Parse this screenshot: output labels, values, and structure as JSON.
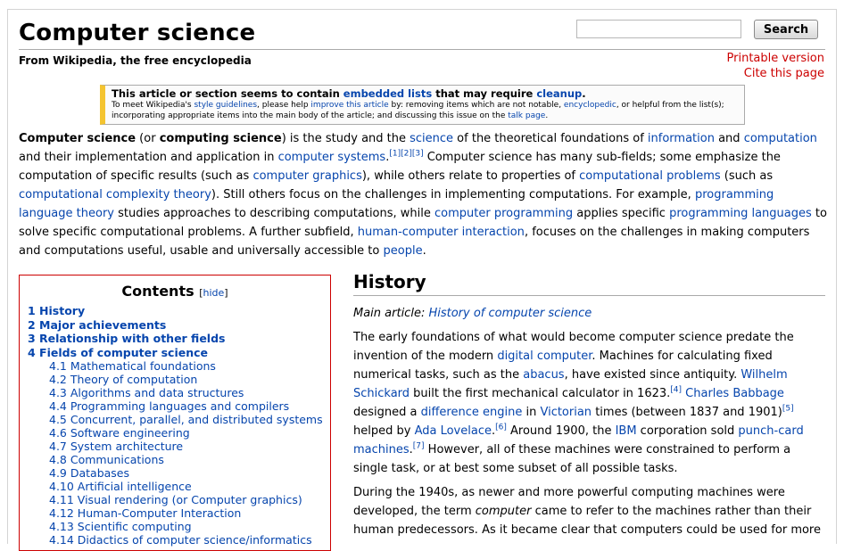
{
  "article": {
    "title": "Computer science",
    "tagline": "From Wikipedia, the free encyclopedia"
  },
  "search": {
    "placeholder": "",
    "value": "",
    "button_label": "Search"
  },
  "pagetools": {
    "printable": "Printable version",
    "cite": "Cite this page"
  },
  "ambox": {
    "lead": [
      "This article or section seems to contain ",
      "embedded lists",
      " that may require ",
      "cleanup",
      "."
    ],
    "body": [
      "To meet Wikipedia's ",
      "style guidelines",
      ", please help ",
      "improve this article",
      " by: removing items which are not notable, ",
      "encyclopedic",
      ", or helpful from the list(s); incorporating appropriate items into the main body of the article; and discussing this issue on the ",
      "talk page",
      "."
    ]
  },
  "intro": [
    "Computer science",
    " (or ",
    "computing science",
    ") is the study and the ",
    "science",
    " of the theoretical foundations of ",
    "information",
    " and ",
    "computation",
    " and their implementation and application in ",
    "computer systems",
    ".",
    "[1][2][3]",
    " Computer science has many sub-fields; some emphasize the computation of specific results (such as ",
    "computer graphics",
    "), while others relate to properties of ",
    "computational problems",
    " (such as ",
    "computational complexity theory",
    "). Still others focus on the challenges in implementing computations. For example, ",
    "programming language theory",
    " studies approaches to describing computations, while ",
    "computer programming",
    " applies specific ",
    "programming languages",
    " to solve specific computational problems. A further subfield, ",
    "human-computer interaction",
    ", focuses on the challenges in making computers and computations useful, usable and universally accessible to ",
    "people",
    "."
  ],
  "toc": {
    "title": "Contents",
    "hide_open": "[",
    "hide_label": "hide",
    "hide_close": "]",
    "items": [
      {
        "level": 1,
        "label": "1 History"
      },
      {
        "level": 1,
        "label": "2 Major achievements"
      },
      {
        "level": 1,
        "label": "3 Relationship with other fields"
      },
      {
        "level": 1,
        "label": "4 Fields of computer science"
      },
      {
        "level": 2,
        "label": "4.1 Mathematical foundations"
      },
      {
        "level": 2,
        "label": "4.2 Theory of computation"
      },
      {
        "level": 2,
        "label": "4.3 Algorithms and data structures"
      },
      {
        "level": 2,
        "label": "4.4 Programming languages and compilers"
      },
      {
        "level": 2,
        "label": "4.5 Concurrent, parallel, and distributed systems"
      },
      {
        "level": 2,
        "label": "4.6 Software engineering"
      },
      {
        "level": 2,
        "label": "4.7 System architecture"
      },
      {
        "level": 2,
        "label": "4.8 Communications"
      },
      {
        "level": 2,
        "label": "4.9 Databases"
      },
      {
        "level": 2,
        "label": "4.10 Artificial intelligence"
      },
      {
        "level": 2,
        "label": "4.11 Visual rendering (or Computer graphics)"
      },
      {
        "level": 2,
        "label": "4.12 Human-Computer Interaction"
      },
      {
        "level": 2,
        "label": "4.13 Scientific computing"
      },
      {
        "level": 2,
        "label": "4.14 Didactics of computer science/informatics"
      }
    ]
  },
  "history": {
    "heading": "History",
    "main_article_prefix": "Main article: ",
    "main_article_link": "History of computer science",
    "p1": [
      "The early foundations of what would become computer science predate the invention of the modern ",
      "digital computer",
      ". Machines for calculating fixed numerical tasks, such as the ",
      "abacus",
      ", have existed since antiquity. ",
      "Wilhelm Schickard",
      " built the first mechanical calculator in 1623.",
      "[4]",
      " ",
      "Charles Babbage",
      " designed a ",
      "difference engine",
      " in ",
      "Victorian",
      " times (between 1837 and 1901)",
      "[5]",
      " helped by ",
      "Ada Lovelace",
      ".",
      "[6]",
      " Around 1900, the ",
      "IBM",
      " corporation sold ",
      "punch-card machines",
      ".",
      "[7]",
      " However, all of these machines were constrained to perform a single task, or at best some subset of all possible tasks."
    ],
    "p2": [
      "During the 1940s, as newer and more powerful computing machines were developed, the term ",
      "computer",
      " came to refer to the machines rather than their human predecessors. As it became clear that computers could be used for more"
    ]
  }
}
